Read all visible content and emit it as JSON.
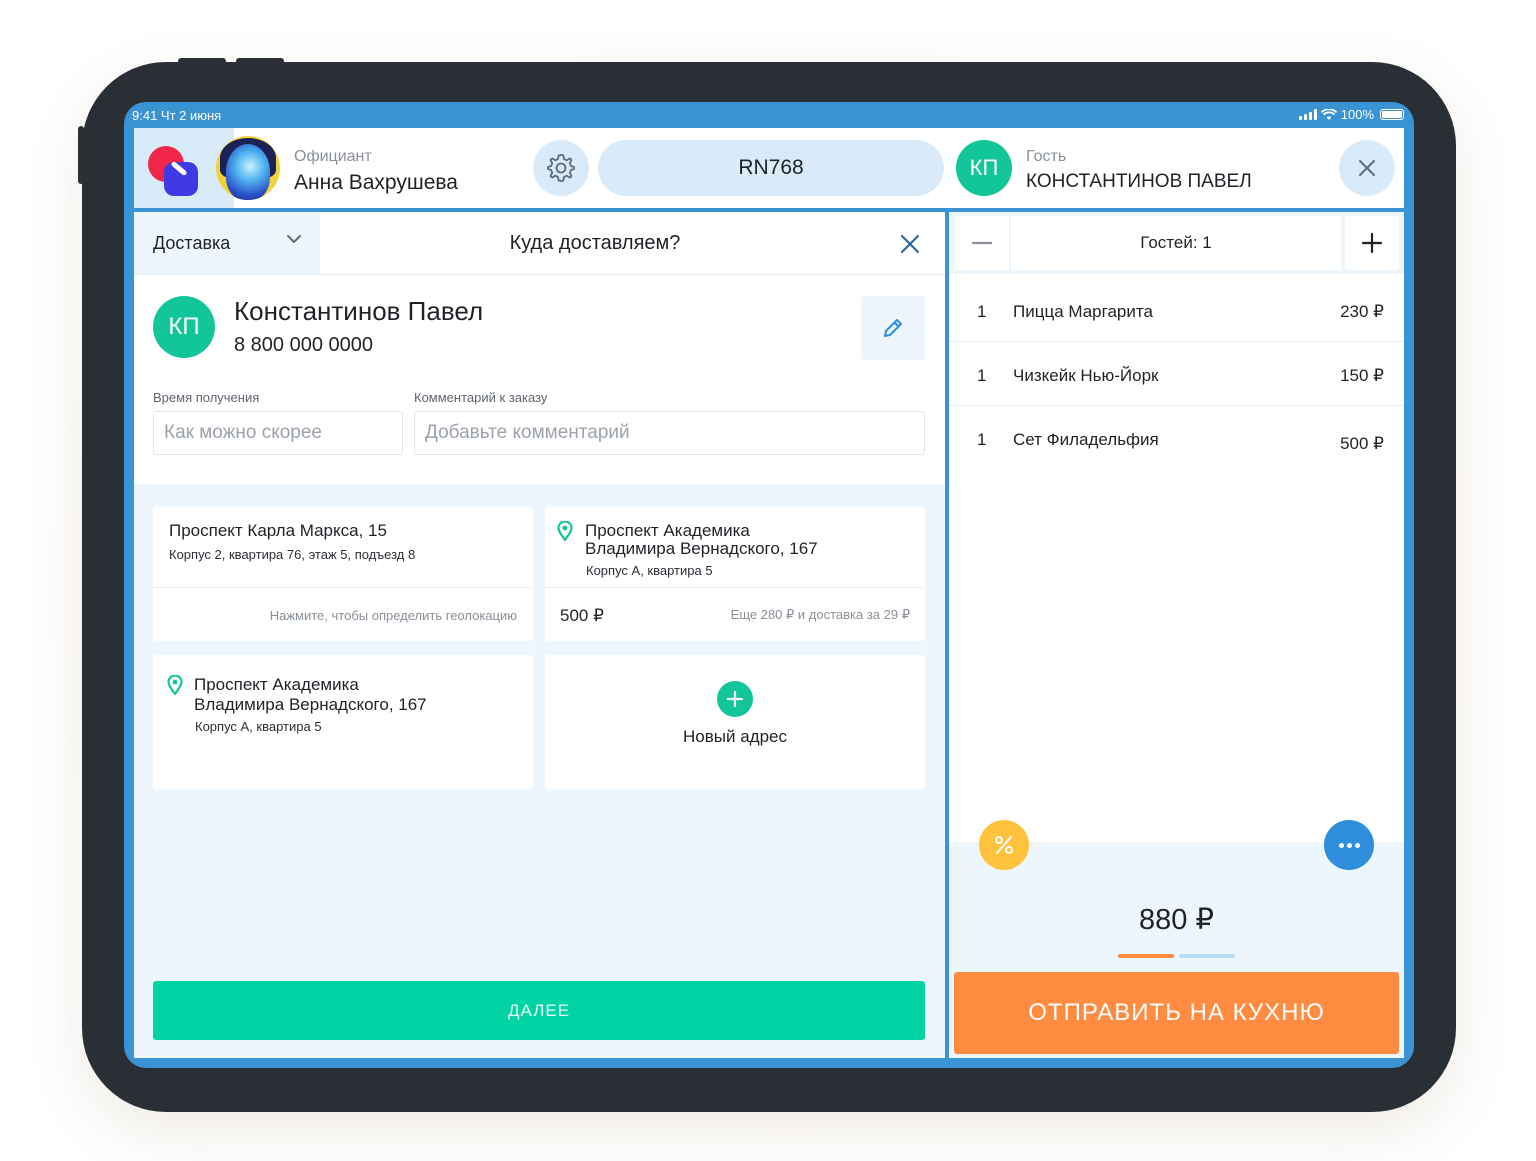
{
  "status_bar": {
    "time_date": "9:41  Чт 2 июня",
    "battery": "100%"
  },
  "header": {
    "waiter_role": "Официант",
    "waiter_name": "Анна Вахрушева",
    "order_id": "RN768",
    "guest_initials": "КП",
    "guest_role": "Гость",
    "guest_name": "КОНСТАНТИНОВ ПАВЕЛ"
  },
  "delivery": {
    "mode_label": "Доставка",
    "title": "Куда доставляем?",
    "client": {
      "initials": "КП",
      "name": "Константинов Павел",
      "phone": "8 800 000 0000"
    },
    "time_label": "Время получения",
    "time_value": "Как можно скорее",
    "comment_label": "Комментарий к заказу",
    "comment_placeholder": "Добавьте комментарий",
    "addresses": [
      {
        "line1": "Проспект Карла Маркса, 15",
        "line2": "Корпус 2, квартира 76, этаж 5, подъезд 8",
        "hint": "Нажмите, чтобы определить геолокацию"
      },
      {
        "line1a": "Проспект Академика",
        "line1b": "Владимира Вернадского, 167",
        "line2": "Корпус А, квартира 5",
        "price": "500 ₽",
        "hint": "Еще 280 ₽ и доставка за 29 ₽"
      },
      {
        "line1a": "Проспект Академика",
        "line1b": "Владимира Вернадского, 167",
        "line2": "Корпус А, квартира 5"
      }
    ],
    "new_address_label": "Новый адрес",
    "next_label": "ДАЛЕЕ"
  },
  "order": {
    "guests_label": "Гостей: 1",
    "items": [
      {
        "qty": "1",
        "name": "Пицца Маргарита",
        "price": "230 ₽"
      },
      {
        "qty": "1",
        "name": "Чизкейк Нью-Йорк",
        "price": "150 ₽"
      },
      {
        "qty": "1",
        "name": "Сет Филадельфия",
        "price": "500 ₽"
      }
    ],
    "total": "880 ₽",
    "send_label": "ОТПРАВИТЬ НА КУХНЮ"
  },
  "colors": {
    "accent_blue": "#3a93d3",
    "green": "#00d4a4",
    "orange": "#ff8c40",
    "yellow": "#ffc23c"
  },
  "icons": [
    "gear-icon",
    "close-icon",
    "chevron-down-icon",
    "pencil-icon",
    "map-pin-icon",
    "plus-icon",
    "minus-icon",
    "percent-icon",
    "more-icon"
  ]
}
